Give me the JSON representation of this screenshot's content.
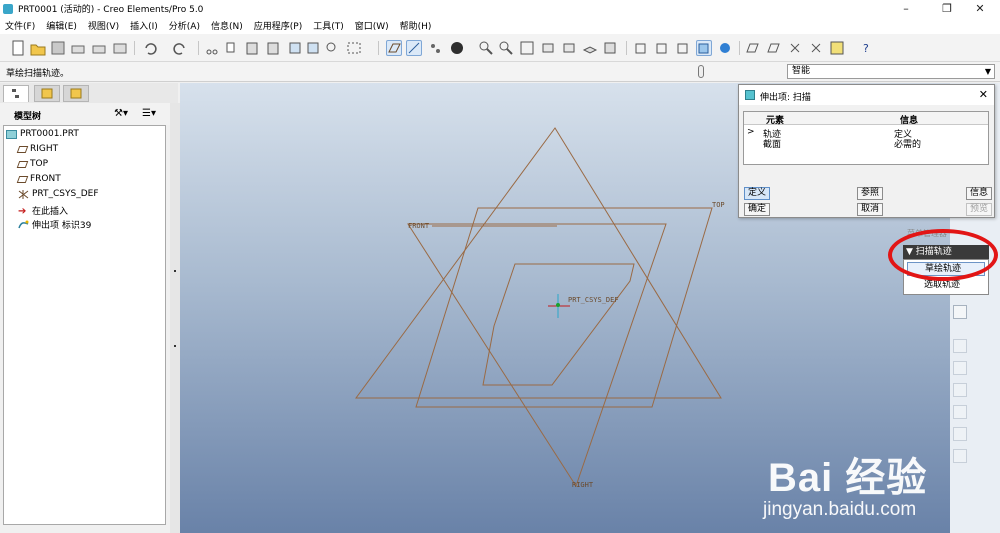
{
  "window": {
    "title": "PRT0001 (活动的) - Creo Elements/Pro 5.0",
    "minimize": "–",
    "maximize": "❐",
    "close": "✕"
  },
  "menubar": {
    "items": [
      "文件(F)",
      "编辑(E)",
      "视图(V)",
      "插入(I)",
      "分析(A)",
      "信息(N)",
      "应用程序(P)",
      "工具(T)",
      "窗口(W)",
      "帮助(H)"
    ]
  },
  "message": {
    "text": "草绘扫描轨迹。",
    "filter": "智能"
  },
  "model_tree": {
    "title": "模型树",
    "items": [
      "PRT0001.PRT",
      "RIGHT",
      "TOP",
      "FRONT",
      "PRT_CSYS_DEF",
      "在此插入",
      "伸出项 标识39"
    ]
  },
  "viewport": {
    "labels": {
      "front": "FRONT",
      "top": "TOP",
      "right": "RIGHT",
      "csys": "PRT_CSYS_DEF"
    },
    "datum_color": "#9a6a44",
    "background_top": "#d7e1ec",
    "background_bottom": "#6982a8"
  },
  "feature_dialog": {
    "title": "伸出项: 扫描",
    "col_element": "元素",
    "col_info": "信息",
    "rows": [
      {
        "marker": ">",
        "element": "轨迹",
        "info": "定义"
      },
      {
        "marker": "",
        "element": "截面",
        "info": "必需的"
      }
    ],
    "buttons": {
      "define": "定义",
      "reference": "参照",
      "info": "信息",
      "ok": "确定",
      "cancel": "取消",
      "preview": "预览"
    }
  },
  "menu_manager": {
    "title": "菜单管理器",
    "section": "扫描轨迹",
    "items": [
      "草绘轨迹",
      "选取轨迹"
    ]
  },
  "watermark": {
    "brand": "Bai 经验",
    "site": "jingyan.baidu.com"
  },
  "colors": {
    "highlight": "#e21515",
    "accent": "#5f8fc8"
  }
}
